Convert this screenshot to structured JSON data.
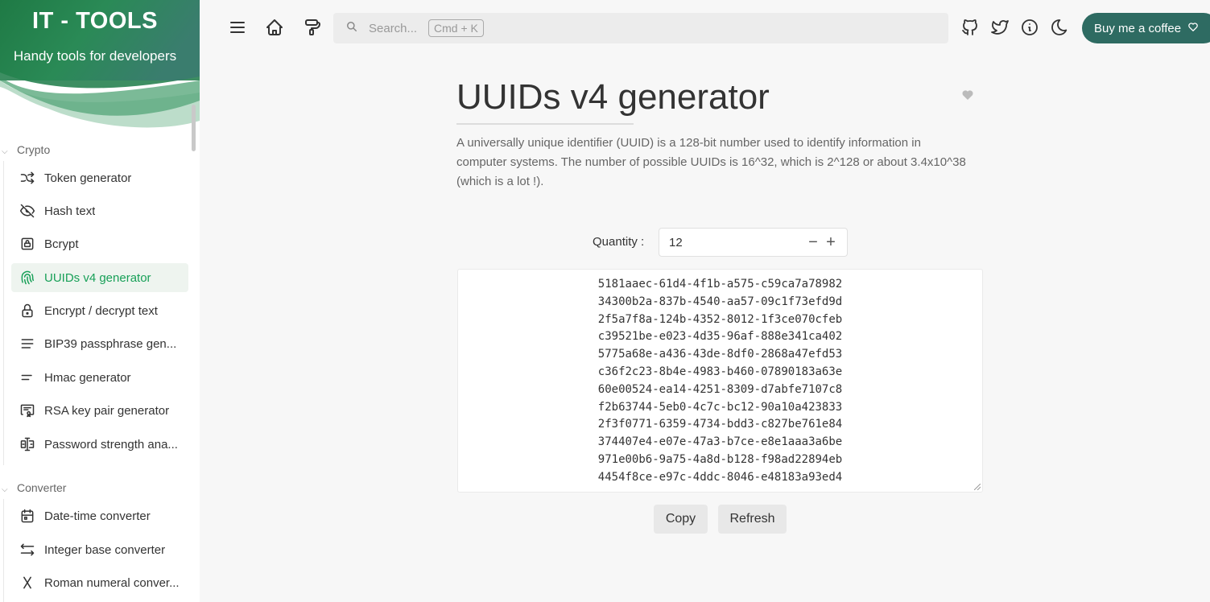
{
  "sidebar": {
    "app_title": "IT - TOOLS",
    "app_subtitle": "Handy tools for developers",
    "sections": [
      {
        "name": "Crypto",
        "items": [
          {
            "label": "Token generator",
            "icon": "shuffle-icon"
          },
          {
            "label": "Hash text",
            "icon": "eye-off-icon"
          },
          {
            "label": "Bcrypt",
            "icon": "lock-square-icon"
          },
          {
            "label": "UUIDs v4 generator",
            "icon": "fingerprint-icon",
            "active": true
          },
          {
            "label": "Encrypt / decrypt text",
            "icon": "lock-open-icon"
          },
          {
            "label": "BIP39 passphrase gen...",
            "icon": "align-justified-icon"
          },
          {
            "label": "Hmac generator",
            "icon": "short-text-icon"
          },
          {
            "label": "RSA key pair generator",
            "icon": "certificate-icon"
          },
          {
            "label": "Password strength ana...",
            "icon": "password-icon"
          }
        ]
      },
      {
        "name": "Converter",
        "items": [
          {
            "label": "Date-time converter",
            "icon": "calendar-icon"
          },
          {
            "label": "Integer base converter",
            "icon": "arrows-left-right-icon"
          },
          {
            "label": "Roman numeral conver...",
            "icon": "letter-x-icon"
          }
        ]
      }
    ]
  },
  "topbar": {
    "search_placeholder": "Search...",
    "search_shortcut": "Cmd + K",
    "coffee_label": "Buy me a coffee"
  },
  "main": {
    "title": "UUIDs v4 generator",
    "description": "A universally unique identifier (UUID) is a 128-bit number used to identify information in computer systems. The number of possible UUIDs is 16^32, which is 2^128 or about 3.4x10^38 (which is a lot !).",
    "quantity_label": "Quantity :",
    "quantity_value": "12",
    "uuids": [
      "5181aaec-61d4-4f1b-a575-c59ca7a78982",
      "34300b2a-837b-4540-aa57-09c1f73efd9d",
      "2f5a7f8a-124b-4352-8012-1f3ce070cfeb",
      "c39521be-e023-4d35-96af-888e341ca402",
      "5775a68e-a436-43de-8df0-2868a47efd53",
      "c36f2c23-8b4e-4983-b460-07890183a63e",
      "60e00524-ea14-4251-8309-d7abfe7107c8",
      "f2b63744-5eb0-4c7c-bc12-90a10a423833",
      "2f3f0771-6359-4734-bdd3-c827be761e84",
      "374407e4-e07e-47a3-b7ce-e8e1aaa3a6be",
      "971e00b6-9a75-4a8d-b128-f98ad22894eb",
      "4454f8ce-e97c-4ddc-8046-e48183a93ed4"
    ],
    "copy_label": "Copy",
    "refresh_label": "Refresh"
  },
  "colors": {
    "accent": "#18a058",
    "hero_start": "#2a7a4f",
    "hero_end": "#3a7a6a",
    "coffee_bg": "#2e6b62"
  }
}
